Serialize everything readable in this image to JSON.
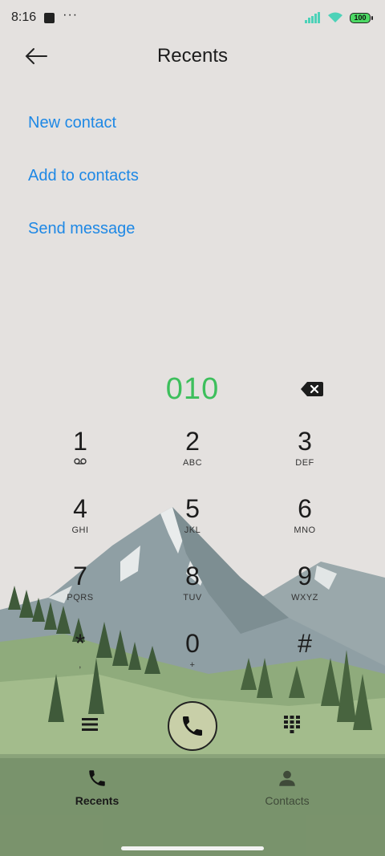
{
  "status_bar": {
    "time": "8:16",
    "dots": "···",
    "battery": "100"
  },
  "header": {
    "title": "Recents"
  },
  "actions": [
    "New contact",
    "Add to contacts",
    "Send message"
  ],
  "dialer": {
    "number": "010",
    "keys": [
      {
        "digit": "1",
        "letters": ""
      },
      {
        "digit": "2",
        "letters": "ABC"
      },
      {
        "digit": "3",
        "letters": "DEF"
      },
      {
        "digit": "4",
        "letters": "GHI"
      },
      {
        "digit": "5",
        "letters": "JKL"
      },
      {
        "digit": "6",
        "letters": "MNO"
      },
      {
        "digit": "7",
        "letters": "PQRS"
      },
      {
        "digit": "8",
        "letters": "TUV"
      },
      {
        "digit": "9",
        "letters": "WXYZ"
      },
      {
        "digit": "*",
        "letters": ","
      },
      {
        "digit": "0",
        "letters": "+"
      },
      {
        "digit": "#",
        "letters": ""
      }
    ]
  },
  "bottom_nav": {
    "recents_label": "Recents",
    "contacts_label": "Contacts"
  },
  "colors": {
    "accent_link": "#1e88e5",
    "number_green": "#3dbf5c",
    "background": "#e4e1df"
  },
  "icons": {
    "back": "back-arrow-icon",
    "backspace": "backspace-icon",
    "voicemail": "voicemail-icon",
    "menu": "menu-icon",
    "call": "phone-icon",
    "dialpad": "dialpad-icon",
    "recents_tab": "phone-icon",
    "contacts_tab": "person-icon",
    "signal": "signal-icon",
    "wifi": "wifi-icon",
    "battery": "battery-icon"
  }
}
